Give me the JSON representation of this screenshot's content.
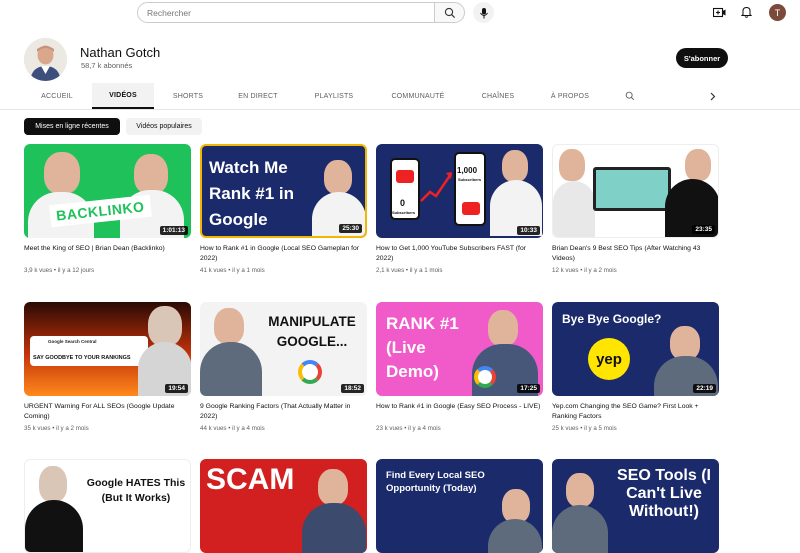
{
  "header": {
    "search_placeholder": "Rechercher",
    "user_initial": "T"
  },
  "channel": {
    "name": "Nathan Gotch",
    "subscribers": "58,7 k abonnés",
    "subscribe_label": "S'abonner"
  },
  "tabs": [
    "ACCUEIL",
    "VIDÉOS",
    "SHORTS",
    "EN DIRECT",
    "PLAYLISTS",
    "COMMUNAUTÉ",
    "CHAÎNES",
    "À PROPOS"
  ],
  "active_tab": "VIDÉOS",
  "chips": [
    "Mises en ligne récentes",
    "Vidéos populaires"
  ],
  "videos": [
    {
      "title": "Meet the King of SEO | Brian Dean (Backlinko)",
      "meta": "3,9 k vues • il y a 12 jours",
      "duration": "1:01:13",
      "thumb_text": "BACKLINKO"
    },
    {
      "title": "How to Rank #1 in Google (Local SEO Gameplan for 2022)",
      "meta": "41 k vues • il y a 1 mois",
      "duration": "25:30",
      "thumb_text": "Watch Me Rank #1 in Google"
    },
    {
      "title": "How to Get 1,000 YouTube Subscribers FAST (for 2022)",
      "meta": "2,1 k vues • il y a 1 mois",
      "duration": "10:33",
      "thumb_text": "1,000"
    },
    {
      "title": "Brian Dean's 9 Best SEO Tips (After Watching 43 Videos)",
      "meta": "12 k vues • il y a 2 mois",
      "duration": "23:35",
      "thumb_text": ""
    },
    {
      "title": "URGENT Warning For ALL SEOs (Google Update Coming)",
      "meta": "35 k vues • il y a 2 mois",
      "duration": "19:54",
      "thumb_text": "SAY GOODBYE TO YOUR RANKINGS"
    },
    {
      "title": "9 Google Ranking Factors (That Actually Matter in 2022)",
      "meta": "44 k vues • il y a 4 mois",
      "duration": "18:52",
      "thumb_text": "MANIPULATE GOOGLE..."
    },
    {
      "title": "How to Rank #1 in Google (Easy SEO Process - LIVE)",
      "meta": "23 k vues • il y a 4 mois",
      "duration": "17:25",
      "thumb_text": "RANK #1 (Live Demo)"
    },
    {
      "title": "Yep.com Changing the SEO Game? First Look + Ranking Factors",
      "meta": "25 k vues • il y a 5 mois",
      "duration": "22:19",
      "thumb_text": "Bye Bye Google?"
    },
    {
      "title": "",
      "meta": "",
      "duration": "",
      "thumb_text": "Google HATES This (But It Works)"
    },
    {
      "title": "",
      "meta": "",
      "duration": "",
      "thumb_text": "SCAM"
    },
    {
      "title": "",
      "meta": "",
      "duration": "",
      "thumb_text": "Find Every Local SEO Opportunity (Today)"
    },
    {
      "title": "",
      "meta": "",
      "duration": "",
      "thumb_text": "SEO Tools (I Can't Live Without!)"
    }
  ],
  "thumb_extra": {
    "sub_label_left": "0",
    "subscribers_word": "Subscribers",
    "yep_logo": "yep",
    "google_search_central": "Google Search Central",
    "google_hates_word": "HATES"
  },
  "colors": {
    "accent": "#0f0f0f",
    "green": "#1fc25a",
    "navy": "#1b2a6b",
    "red": "#d21f1f",
    "pink": "#f05ac9",
    "yellow": "#ffe500"
  },
  "icons": [
    "search-icon",
    "mic-icon",
    "create-icon",
    "bell-icon",
    "chevron-right-icon"
  ]
}
